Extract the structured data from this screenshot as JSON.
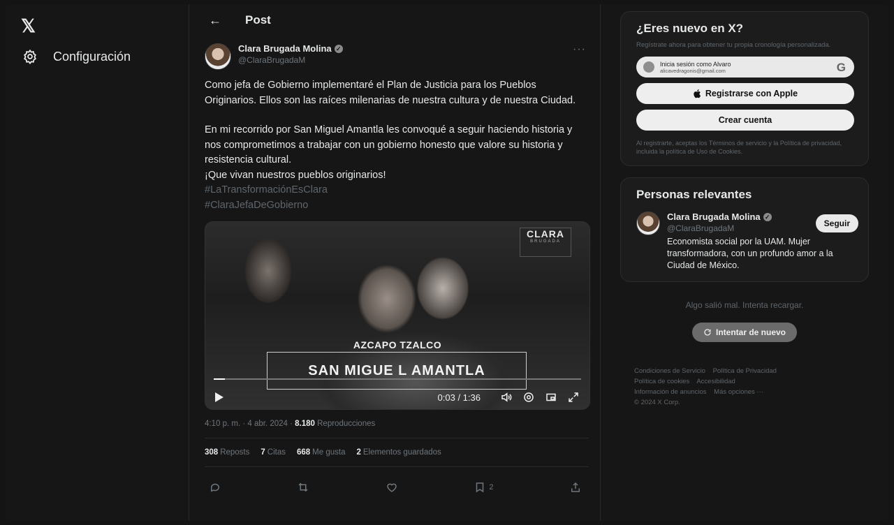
{
  "nav": {
    "logo": "𝕏",
    "settings_label": "Configuración"
  },
  "header": {
    "back_icon": "←",
    "title": "Post"
  },
  "post": {
    "author_name": "Clara Brugada Molina",
    "author_handle": "@ClaraBrugadaM",
    "more_icon": "···",
    "paragraphs": [
      "Como jefa de Gobierno implementaré el Plan de Justicia para los Pueblos Originarios. Ellos son las raíces milenarias de nuestra cultura y de nuestra Ciudad.",
      "En mi recorrido por San Miguel Amantla les convoqué a seguir haciendo historia y nos comprometimos a trabajar con un gobierno honesto que valore su historia y resistencia cultural.",
      "¡Que vivan nuestros pueblos originarios!"
    ],
    "hashtags": [
      "#LaTransformaciónEsClara",
      "#ClaraJefaDeGobierno"
    ],
    "video": {
      "badge_title": "CLARA",
      "badge_sub": "BRUGADA",
      "place_small": "AZCAPO TZALCO",
      "place_big": "SAN MIGUE L AMANTLA",
      "time": "0:03 / 1:36",
      "progress": 0.031
    },
    "timestamp": "4:10 p. m. · 4 abr. 2024 ·",
    "views_count": "8.180",
    "views_label": "Reproducciones",
    "stats": [
      {
        "count": "308",
        "label": "Reposts"
      },
      {
        "count": "7",
        "label": "Citas"
      },
      {
        "count": "668",
        "label": "Me gusta"
      },
      {
        "count": "2",
        "label": "Elementos guardados"
      }
    ],
    "bookmark_count": "2"
  },
  "signup": {
    "title": "¿Eres nuevo en X?",
    "subtitle": "Regístrate ahora para obtener tu propia cronología personalizada.",
    "google_line1": "Inicia sesión como Alvaro",
    "google_line2": "alicavedragonis@gmail.com",
    "apple_label": "Registrarse con Apple",
    "create_label": "Crear cuenta",
    "terms": "Al registrarte, aceptas los Términos de servicio y la Política de privacidad, incluida la política de Uso de Cookies."
  },
  "relevant": {
    "title": "Personas relevantes",
    "name": "Clara Brugada Molina",
    "handle": "@ClaraBrugadaM",
    "follow_label": "Seguir",
    "bio": "Economista social por la UAM. Mujer transformadora, con un profundo amor a la Ciudad de México."
  },
  "error": {
    "text": "Algo salió mal. Intenta recargar.",
    "retry_label": "Intentar de nuevo"
  },
  "footer": {
    "links": [
      "Condiciones de Servicio",
      "Política de Privacidad",
      "Política de cookies",
      "Accesibilidad",
      "Información de anuncios",
      "Más opciones ···"
    ],
    "copyright": "© 2024 X Corp."
  }
}
